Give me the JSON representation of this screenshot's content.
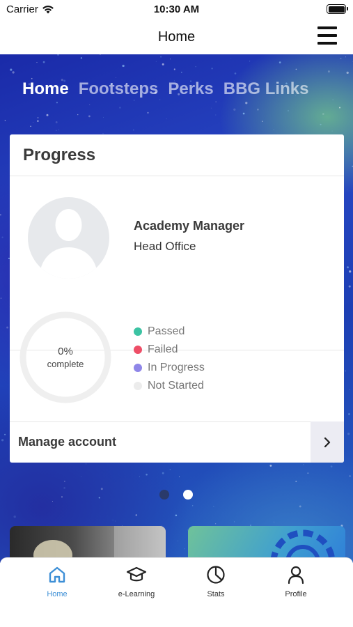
{
  "status_bar": {
    "carrier": "Carrier",
    "time": "10:30 AM"
  },
  "nav": {
    "title": "Home",
    "menu_icon": "hamburger-menu-icon"
  },
  "top_tabs": [
    {
      "label": "Home",
      "active": true
    },
    {
      "label": "Footsteps",
      "active": false
    },
    {
      "label": "Perks",
      "active": false
    },
    {
      "label": "BBG Links",
      "active": false
    }
  ],
  "progress_card": {
    "title": "Progress",
    "user": {
      "name": "Academy Manager",
      "office": "Head Office",
      "avatar_icon": "avatar-placeholder-icon"
    },
    "completion": {
      "percent": "0%",
      "label": "complete",
      "value": 0
    },
    "legend": [
      {
        "label": "Passed",
        "color": "#3cc3a3"
      },
      {
        "label": "Failed",
        "color": "#ee4e67"
      },
      {
        "label": "In Progress",
        "color": "#8f86e8"
      },
      {
        "label": "Not Started",
        "color": "#ececec"
      }
    ],
    "manage": {
      "label": "Manage account",
      "icon": "chevron-right-icon"
    }
  },
  "carousel": {
    "pages": 2,
    "current": 2
  },
  "tab_bar": [
    {
      "label": "Home",
      "icon": "home-icon",
      "active": true
    },
    {
      "label": "e-Learning",
      "icon": "graduation-cap-icon",
      "active": false
    },
    {
      "label": "Stats",
      "icon": "pie-chart-icon",
      "active": false
    },
    {
      "label": "Profile",
      "icon": "user-icon",
      "active": false
    }
  ],
  "colors": {
    "accent": "#3d8fd6",
    "ring_track": "#efefef"
  }
}
